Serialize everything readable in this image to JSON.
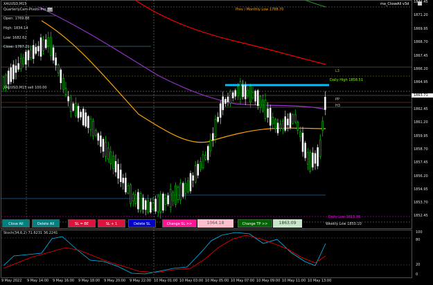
{
  "header": {
    "symbol": "XAUUSD,M15",
    "ea_name": "QuarterlyCam-Pivots-Pro",
    "ea_badge": "TF",
    "top_right": "ma_CloseAll v3d"
  },
  "info_panel": {
    "open": "Open: 1769.88",
    "high": "High: 1834.14",
    "low": "Low: 1682.62",
    "close": "Close: 1787.21"
  },
  "levels": {
    "prev_monthly_low": "Prev / Monthly Low 1788.70",
    "l3": "L3",
    "daily_high": "Daily High 1858.51",
    "pp": "PP",
    "h3": "H3",
    "daily_low": "Daily Low 1815.96",
    "weekly_low": "Weekly Low 1850.10",
    "cursor_label": "XAUUSD,M15 sell 100.00"
  },
  "price_axis": {
    "labels": [
      "1872.45",
      "1871.20",
      "1869.95",
      "1868.70",
      "1867.45",
      "1866.20",
      "1864.95",
      "1863.71",
      "1862.45",
      "1861.20",
      "1859.95",
      "1858.70",
      "1857.45",
      "1856.20",
      "1854.95",
      "1853.70",
      "1852.45"
    ],
    "current_price": "1863.71"
  },
  "buttons": {
    "close_all": "Close All",
    "delete_all": "Delete All",
    "sl_be": "SL = BE",
    "sl_plus1": "SL + 1",
    "delete_sl": "Delete SL",
    "change_sl": "Change SL >>",
    "sl_value": "1064.18",
    "change_tp": "Change TP >>",
    "tp_value": "1863.09"
  },
  "stoch": {
    "title": "Stoch(34,6,2) 71.6231 36.2241",
    "levels": [
      "100",
      "80",
      "20",
      "0"
    ]
  },
  "time_axis": [
    "9 May 2022",
    "9 May 14:00",
    "9 May 16:00",
    "9 May 18:00",
    "9 May 20:00",
    "9 May 22:00",
    "10 May 01:00",
    "10 May 03:00",
    "10 May 05:00",
    "10 May 07:00",
    "10 May 09:00",
    "10 May 11:00",
    "10 May 13:00"
  ],
  "colors": {
    "background": "#000000",
    "bull_candle": "#00ff00",
    "bear_candle": "#ffffff",
    "ma_red": "#ff0000",
    "ma_purple": "#9932cc",
    "ma_orange": "#ffa500",
    "daily_high_line": "#00bfff",
    "stoch_main": "#00bfff",
    "stoch_signal": "#ff0000"
  }
}
